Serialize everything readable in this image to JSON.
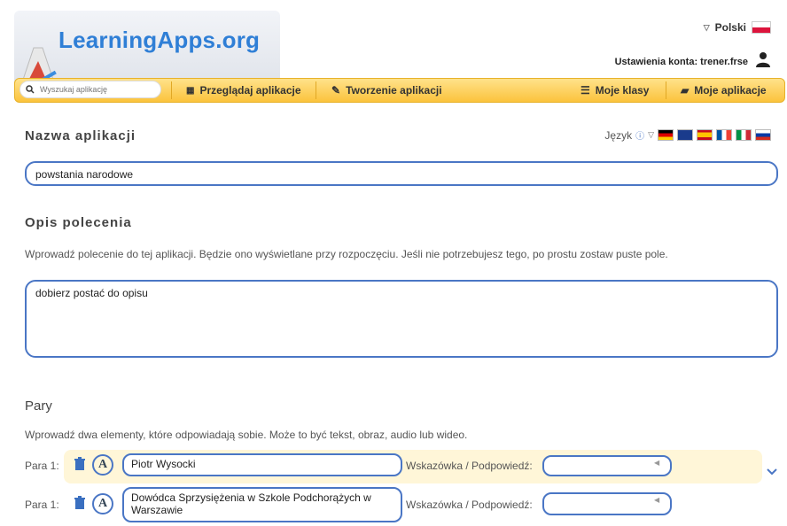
{
  "header": {
    "logo_text": "LearningApps.org",
    "language": "Polski",
    "account": "Ustawienia konta: trener.frse"
  },
  "nav": {
    "search_placeholder": "Wyszukaj aplikację",
    "items": [
      {
        "label": "Przeglądaj aplikacje"
      },
      {
        "label": "Tworzenie aplikacji"
      },
      {
        "label": "Moje klasy"
      },
      {
        "label": "Moje aplikacje"
      }
    ]
  },
  "form": {
    "app_name_title": "Nazwa aplikacji",
    "language_label": "Język",
    "app_name_value": "powstania narodowe",
    "task_title": "Opis polecenia",
    "task_description": "Wprowadź polecenie do tej aplikacji. Będzie ono wyświetlane przy rozpoczęciu. Jeśli nie potrzebujesz tego, po prostu zostaw puste pole.",
    "task_value": "dobierz postać do opisu",
    "pairs_title": "Pary",
    "pairs_description": "Wprowadź dwa elementy, które odpowiadają sobie. Może to być tekst, obraz, audio lub wideo.",
    "pairs": [
      {
        "label": "Para 1:",
        "value": "Piotr Wysocki",
        "hint_label": "Wskazówka / Podpowiedź:"
      },
      {
        "label": "Para 1:",
        "value": "Dowódca Sprzysiężenia w Szkole Podchorążych w Warszawie",
        "hint_label": "Wskazówka / Podpowiedź:"
      }
    ]
  },
  "colors": {
    "accent_blue": "#4a76c5",
    "nav_yellow": "#fbc33c",
    "pair_highlight": "#fff6d8"
  }
}
